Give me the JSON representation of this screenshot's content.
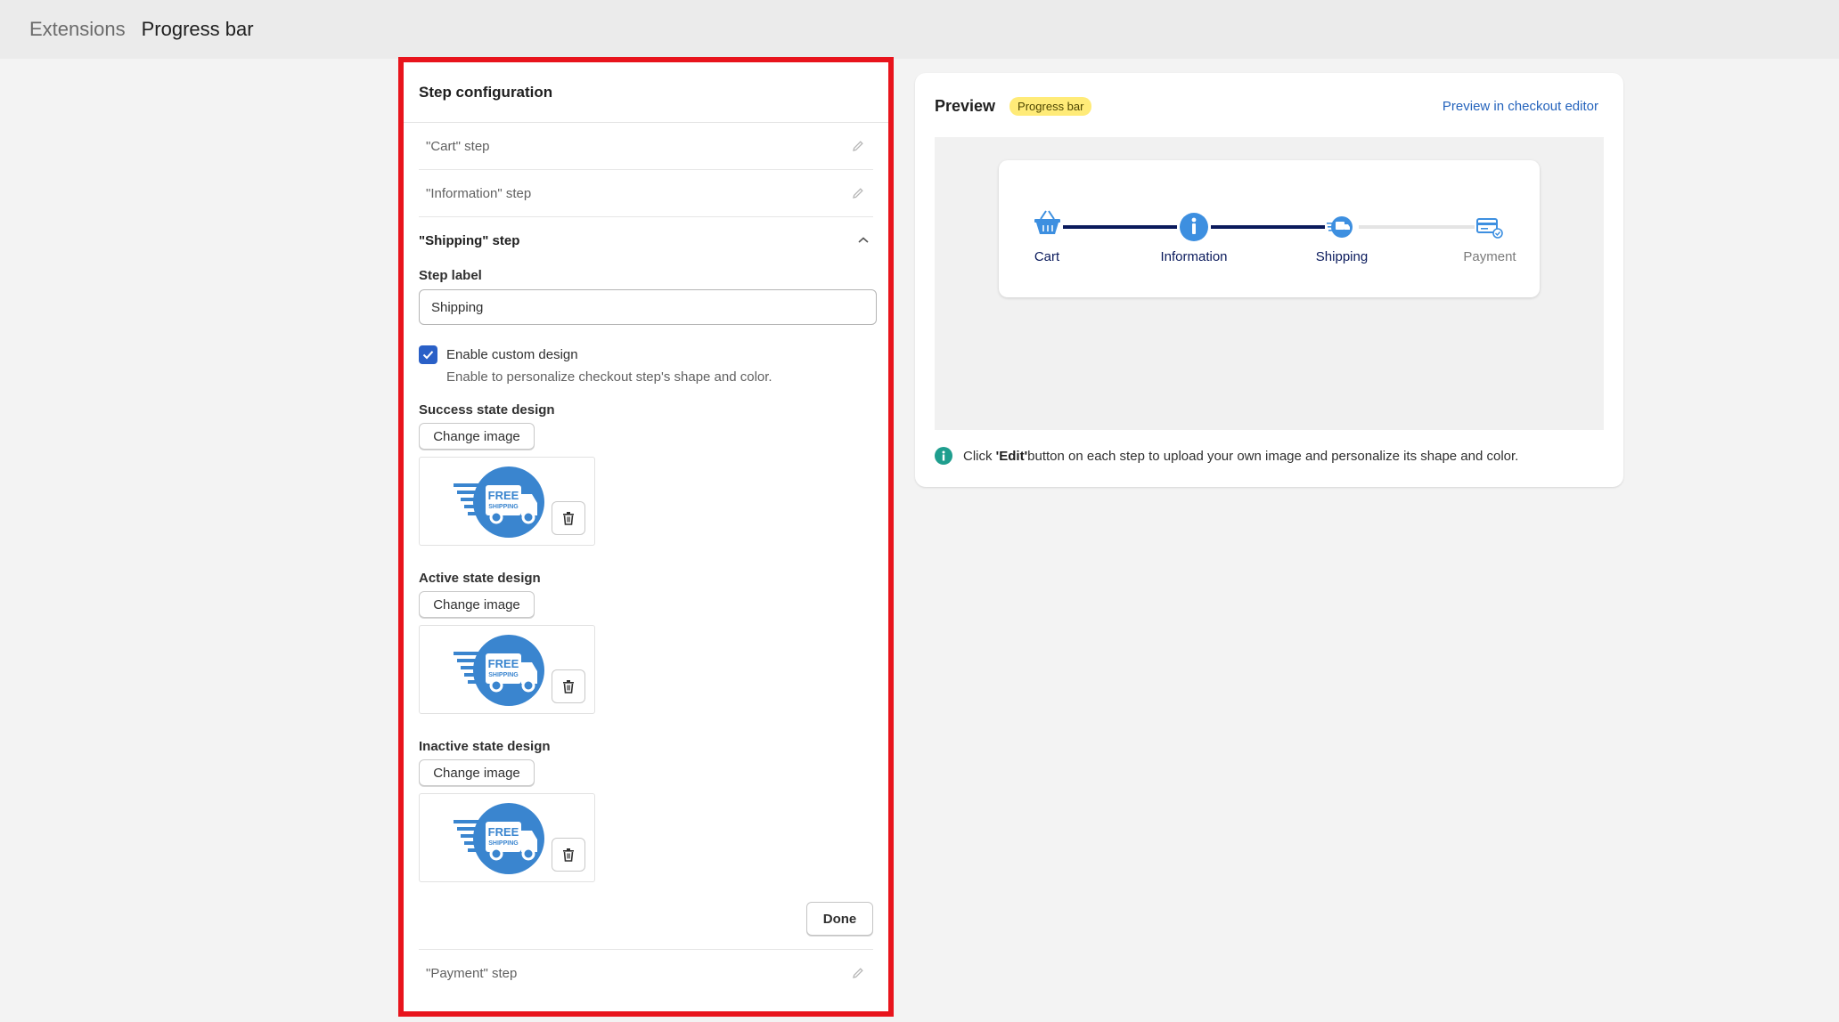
{
  "breadcrumb": {
    "parent": "Extensions",
    "current": "Progress bar"
  },
  "step_config": {
    "title": "Step configuration",
    "collapsed_steps": [
      {
        "label": "\"Cart\" step"
      },
      {
        "label": "\"Information\" step"
      }
    ],
    "expanded_step": {
      "title": "\"Shipping\" step",
      "step_label_title": "Step label",
      "step_label_value": "Shipping",
      "checkbox_checked": true,
      "checkbox_label": "Enable custom design",
      "checkbox_help": "Enable to personalize checkout step's shape and color.",
      "designs": [
        {
          "label": "Success state design",
          "button": "Change image"
        },
        {
          "label": "Active state design",
          "button": "Change image"
        },
        {
          "label": "Inactive state design",
          "button": "Change image"
        }
      ],
      "image_text_line1": "FREE",
      "image_text_line2": "SHIPPING",
      "done_label": "Done"
    },
    "trailing_step": {
      "label": "\"Payment\" step"
    }
  },
  "preview": {
    "title": "Preview",
    "badge": "Progress bar",
    "link": "Preview in checkout editor",
    "steps": [
      {
        "label": "Cart",
        "icon": "basket-icon",
        "state": "completed"
      },
      {
        "label": "Information",
        "icon": "info-icon",
        "state": "completed"
      },
      {
        "label": "Shipping",
        "icon": "truck-icon",
        "state": "active"
      },
      {
        "label": "Payment",
        "icon": "card-icon",
        "state": "inactive"
      }
    ],
    "note_prefix": "Click ",
    "note_bold": "'Edit'",
    "note_suffix": " button on each step to upload your own image and personalize its shape and color."
  },
  "colors": {
    "highlight_border": "#e8141c",
    "primary_blue": "#2a60c7",
    "step_blue": "#3d8fe0",
    "track_dark": "#0a1a5c",
    "track_light": "#e4e4e4",
    "badge_yellow": "#ffeb78",
    "link_blue": "#2463bc",
    "info_teal": "#1f9e8e"
  }
}
